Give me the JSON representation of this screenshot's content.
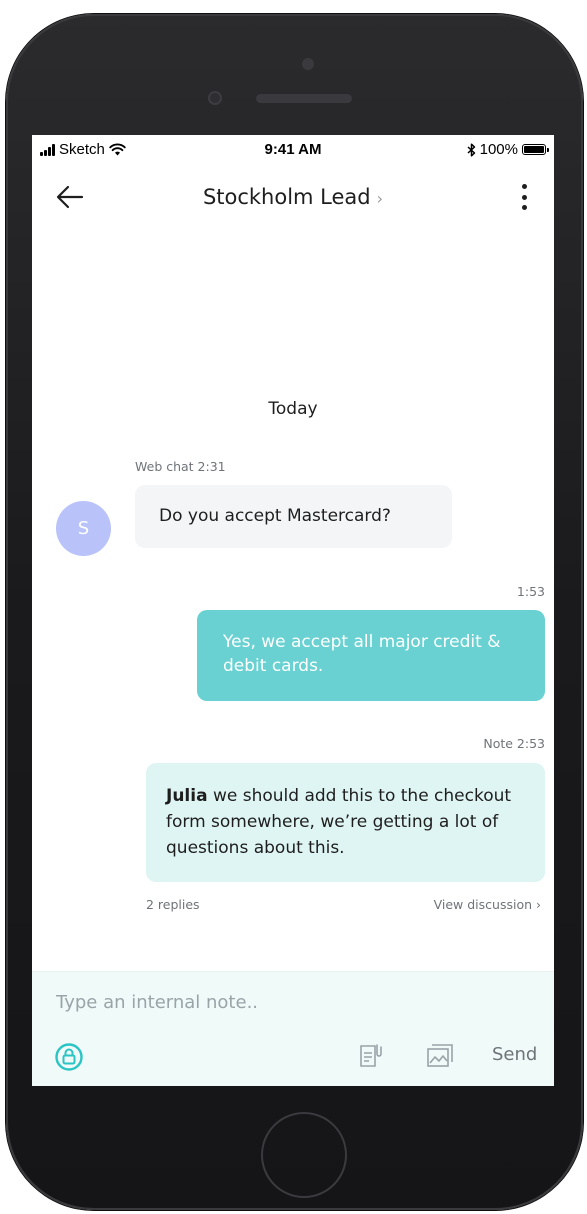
{
  "status_bar": {
    "carrier": "Sketch",
    "time": "9:41 AM",
    "battery": "100%"
  },
  "nav": {
    "title": "Stockholm Lead",
    "title_chevron": "›"
  },
  "conversation": {
    "date_separator": "Today",
    "incoming": {
      "meta": "Web chat 2:31",
      "avatar_initial": "S",
      "text": "Do you accept Mastercard?"
    },
    "outgoing": {
      "meta": "1:53",
      "text": "Yes, we accept all major credit & debit cards."
    },
    "note": {
      "meta": "Note 2:53",
      "author": "Julia",
      "text": " we should add this to the checkout form somewhere, we’re getting a lot of questions about this.",
      "replies": "2 replies",
      "view_discussion": "View discussion ›"
    }
  },
  "composer": {
    "placeholder": "Type an internal note..",
    "send_label": "Send"
  },
  "colors": {
    "teal": "#69d1d1",
    "note_bg": "#dff5f3",
    "avatar": "#b9c3f9",
    "composer_bg": "#effaf9"
  },
  "icons": [
    "back-arrow-icon",
    "chevron-right-icon",
    "more-vertical-icon",
    "lock-icon",
    "template-icon",
    "image-icon",
    "wifi-icon",
    "bluetooth-icon",
    "battery-icon",
    "signal-icon"
  ]
}
